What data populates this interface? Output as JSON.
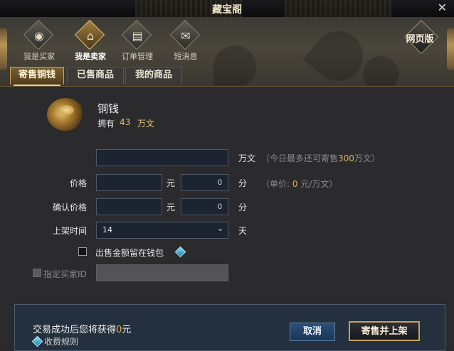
{
  "window": {
    "title": "藏宝阁",
    "close_glyph": "✕"
  },
  "nav": {
    "items": [
      {
        "label": "我是买家",
        "icon": "coin-seal-icon",
        "glyph": "◉",
        "active": false
      },
      {
        "label": "我是卖家",
        "icon": "pavilion-icon",
        "glyph": "⌂",
        "active": true
      },
      {
        "label": "订单管理",
        "icon": "book-icon",
        "glyph": "▤",
        "active": false
      },
      {
        "label": "短消息",
        "icon": "envelope-icon",
        "glyph": "✉",
        "active": false
      }
    ],
    "web_version": "网页版"
  },
  "tabs": [
    {
      "label": "寄售铜钱",
      "active": true
    },
    {
      "label": "已售商品",
      "active": false
    },
    {
      "label": "我的商品",
      "active": false
    }
  ],
  "item": {
    "name": "铜钱",
    "own_label": "拥有",
    "own_value": "43",
    "own_unit": "万文",
    "icon": "copper-coins-icon"
  },
  "form": {
    "amount": {
      "value": "",
      "unit": "万文",
      "hint_prefix": "（今日最多还可寄售",
      "hint_limit": "300",
      "hint_suffix": "万文）"
    },
    "price": {
      "label": "价格",
      "yuan_value": "",
      "yuan_unit": "元",
      "fen_value": "0",
      "fen_unit": "分",
      "hint_prefix": "（单价:",
      "hint_value": "0",
      "hint_suffix": "元/万文）"
    },
    "confirm_price": {
      "label": "确认价格",
      "yuan_value": "",
      "yuan_unit": "元",
      "fen_value": "0",
      "fen_unit": "分"
    },
    "listing_time": {
      "label": "上架时间",
      "value": "14",
      "unit": "天"
    },
    "keep_in_wallet": {
      "label": "出售金额留在钱包",
      "checked": false
    },
    "buyer_id": {
      "label": "指定买家ID",
      "checked": false,
      "value": ""
    }
  },
  "footer": {
    "gain_prefix": "交易成功后您将获得",
    "gain_value": "0",
    "gain_suffix": "元",
    "fee_rules": "收费规则",
    "cancel_label": "取消",
    "submit_label": "寄售并上架"
  },
  "colors": {
    "accent_gold": "#e4c272",
    "gain_orange": "#e0b24a",
    "hint_gray": "#8a8a8a"
  }
}
